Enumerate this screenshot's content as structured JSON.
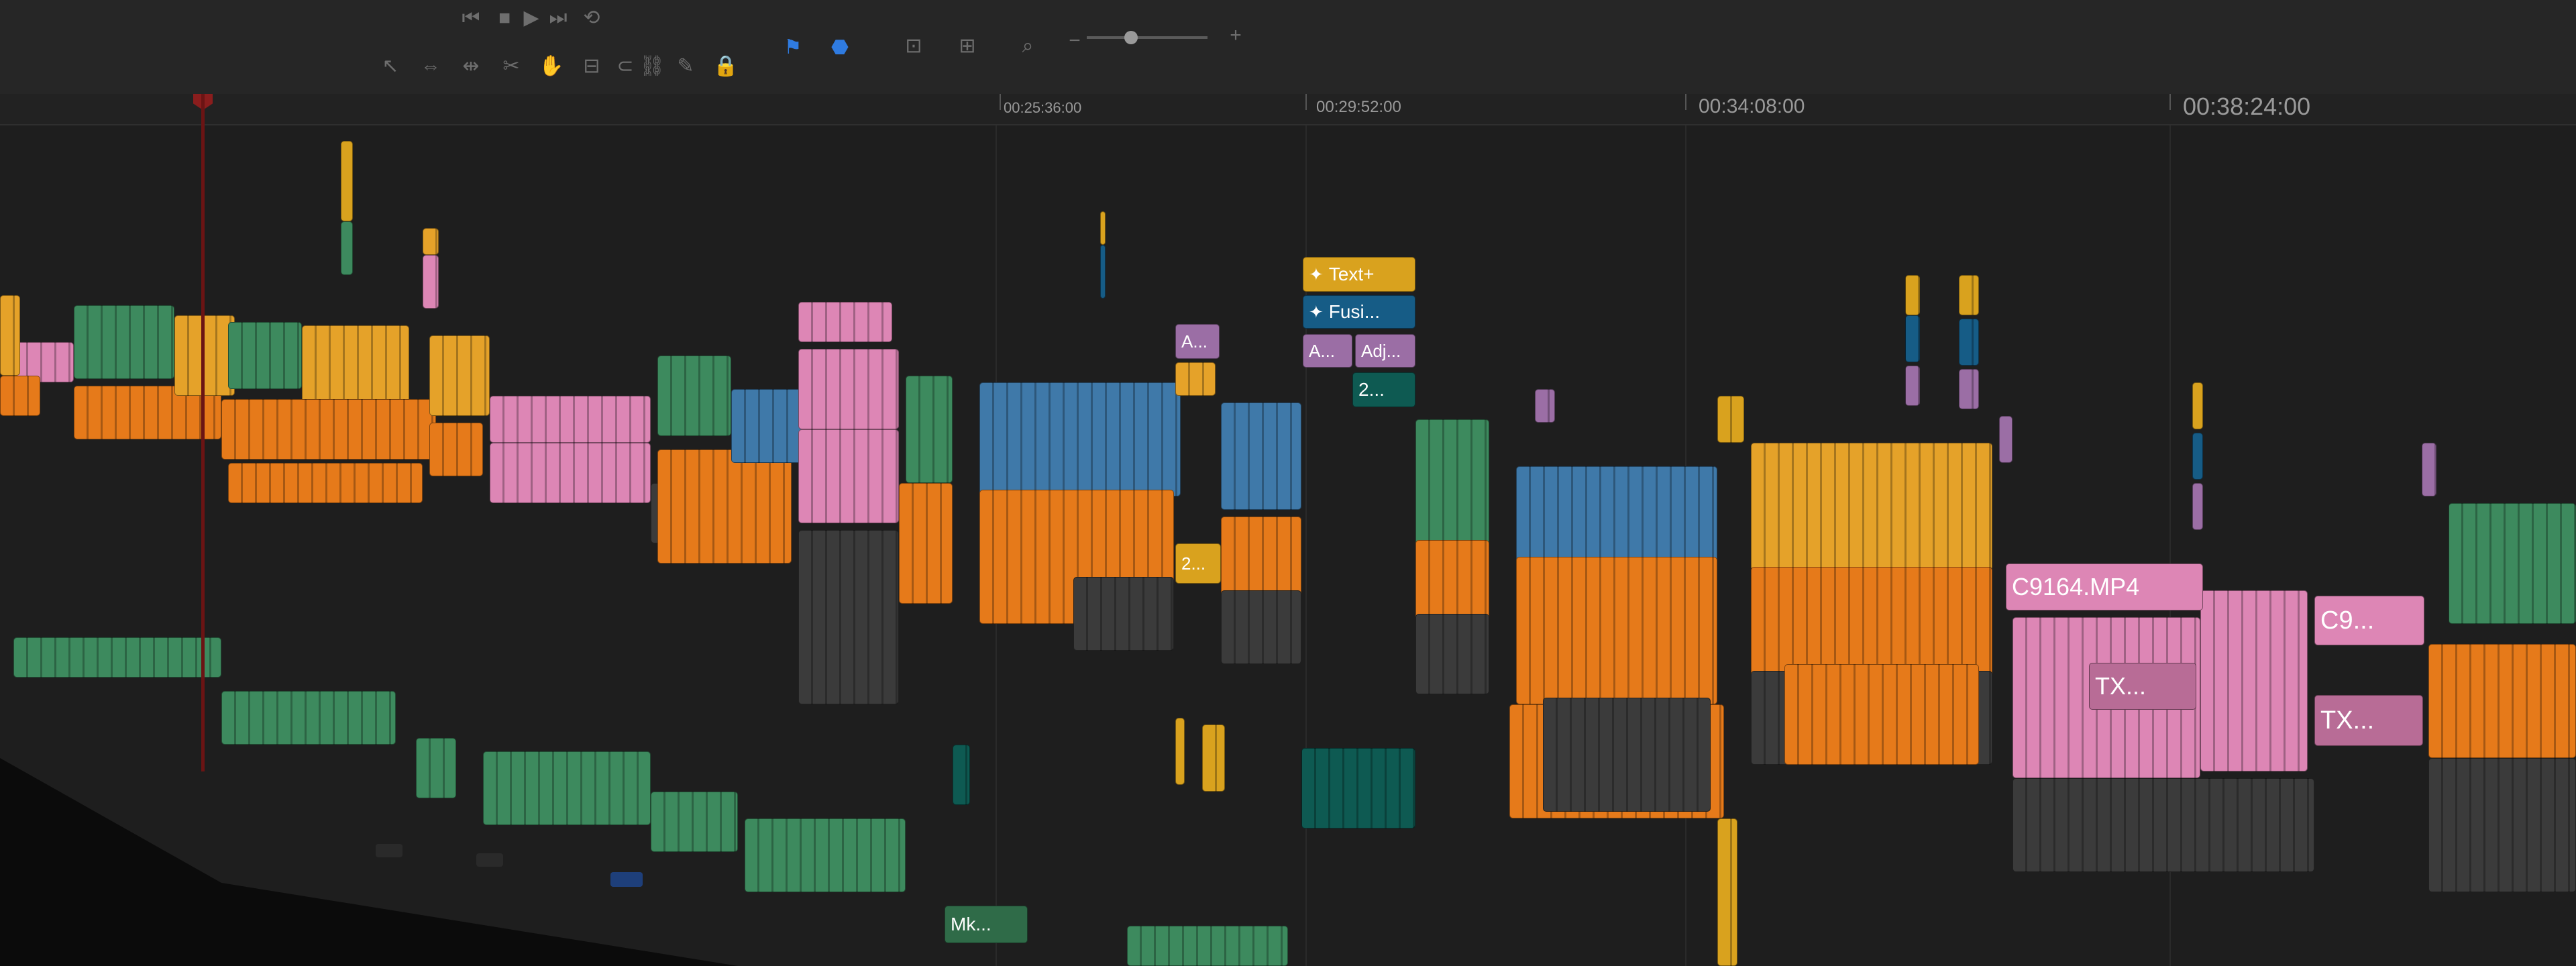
{
  "colors": {
    "orange": "#e67a1a",
    "amber": "#e5a229",
    "blue": "#3f79a9",
    "pink": "#dd86b5",
    "mauve": "#9b6ea5",
    "green": "#3d8a5e",
    "teal": "#0e5a52",
    "yellow": "#d9a21e",
    "dark": "#3b3b3b",
    "navy": "#165c86"
  },
  "toolbar": {
    "icons": [
      "skip-back-icon",
      "stop-icon",
      "play-icon",
      "skip-forward-icon",
      "loop-icon",
      "pointer-icon",
      "trim-icon",
      "dynamic-trim-icon",
      "blade-icon",
      "hand-icon",
      "snap-icon",
      "magnet-icon",
      "link-icon",
      "pencil-icon",
      "lock-icon",
      "flag-icon",
      "marker-icon",
      "zoom-fit-icon",
      "zoom-detail-icon",
      "zoom-custom-icon",
      "zoom-out-icon",
      "zoom-in-icon"
    ]
  },
  "ruler": {
    "timecodes": [
      "00:25:36:00",
      "00:29:52:00",
      "00:34:08:00",
      "00:38:24:00"
    ]
  },
  "clips": {
    "text_plus": "Text+",
    "fusion": "Fusi...",
    "adj_a": "A...",
    "adj": "Adj...",
    "compound": "2...",
    "purple_a": "A...",
    "yellow_2": "2...",
    "c9164": "C9164.MP4",
    "c9": "C9...",
    "tx1": "TX...",
    "tx2": "TX...",
    "mk": "Mk..."
  }
}
